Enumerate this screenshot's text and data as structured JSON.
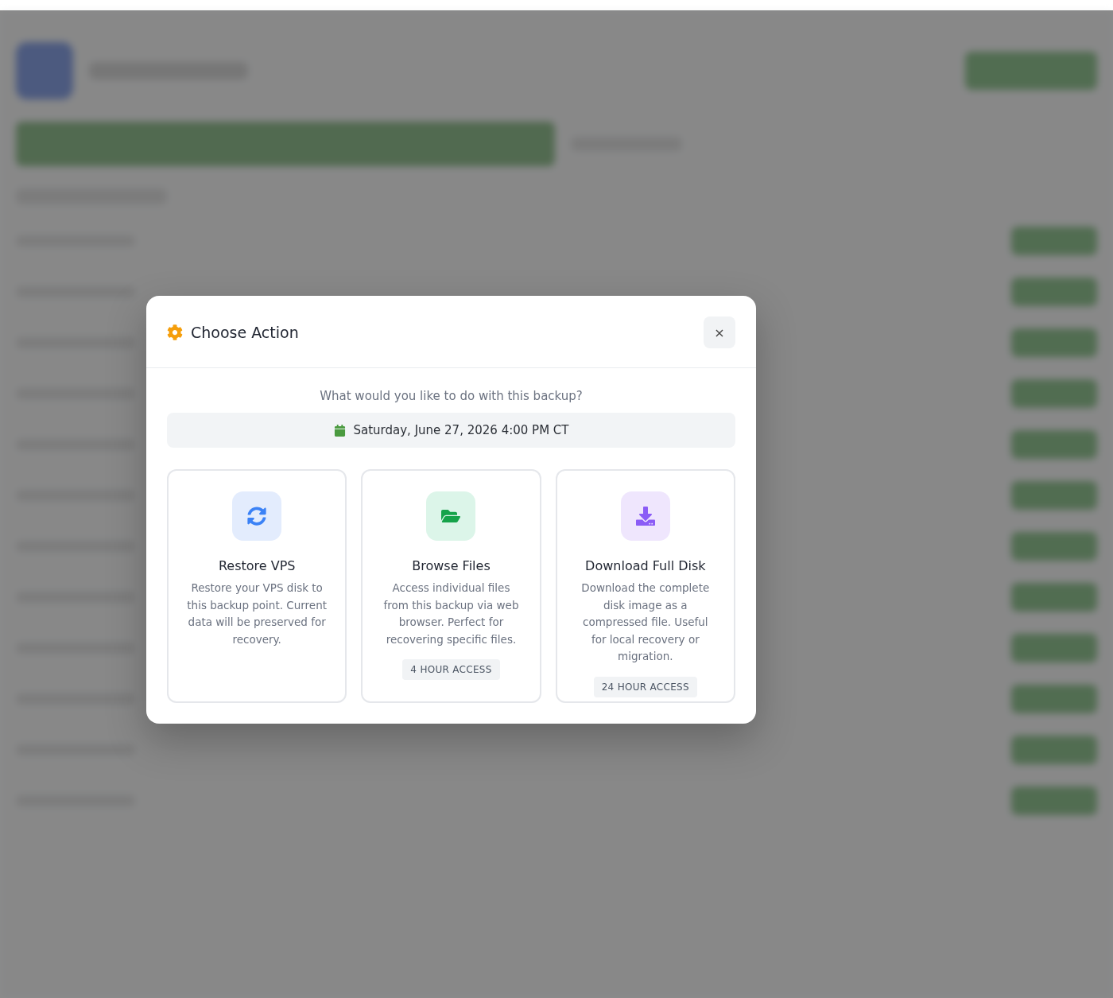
{
  "dialog": {
    "title": "Choose Action",
    "close": "×",
    "question": "What would you like to do with this backup?",
    "date": "Saturday, June 27, 2026 4:00 PM CT",
    "actions": [
      {
        "kind": "restore",
        "title": "Restore VPS",
        "description": "Restore your VPS disk to this backup point. Current data will be preserved for recovery."
      },
      {
        "kind": "browse",
        "title": "Browse Files",
        "description": "Access individual files from this backup via web browser. Perfect for recovering specific files.",
        "badge": "4 HOUR ACCESS"
      },
      {
        "kind": "download",
        "title": "Download Full Disk",
        "description": "Download the complete disk image as a compressed file. Useful for local recovery or migration.",
        "badge": "24 HOUR ACCESS"
      }
    ]
  }
}
